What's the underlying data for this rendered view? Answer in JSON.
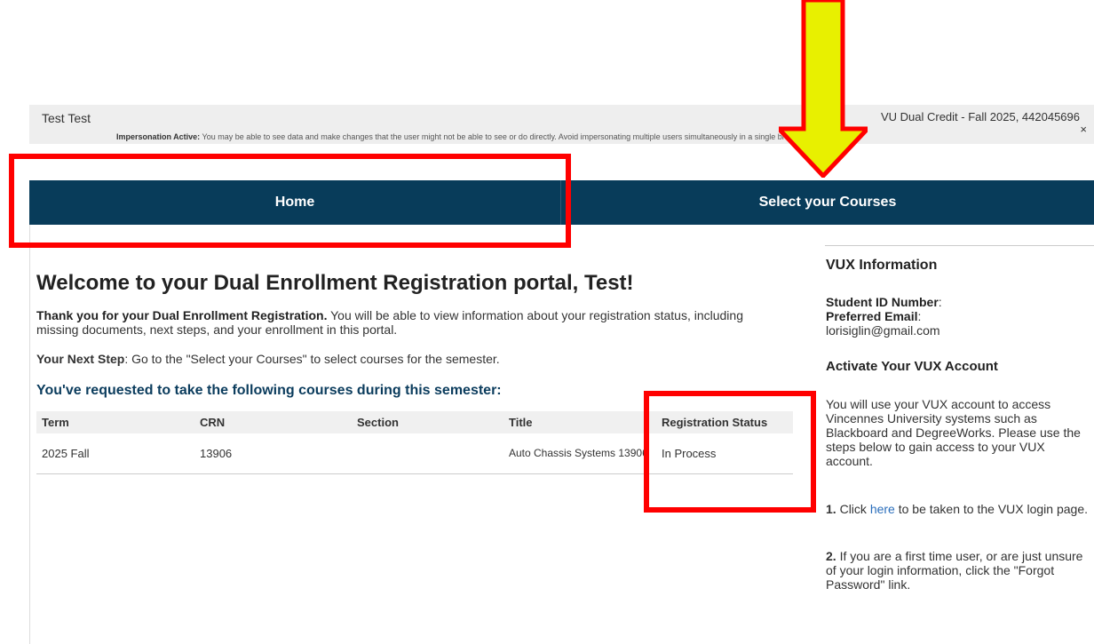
{
  "header": {
    "user_name": "Test Test",
    "impersonation_label": "Impersonation Active:",
    "impersonation_text": "You may be able to see data and make changes that the user might not be able to see or do directly. Avoid impersonating multiple users simultaneously in a single browser session.",
    "session_info": "VU Dual Credit - Fall 2025, 442045696",
    "close_glyph": "×"
  },
  "nav": {
    "home_label": "Home",
    "select_courses_label": "Select your Courses"
  },
  "main": {
    "welcome": "Welcome to your Dual Enrollment Registration portal, Test!",
    "intro_bold": "Thank you for your Dual Enrollment Registration.",
    "intro_text": " You will be able to view information about your registration status, including missing documents, next steps, and your enrollment in this portal.",
    "next_step_label": "Your Next Step",
    "next_step_text": ": Go to the \"Select your Courses\" to select courses for the semester.",
    "courses_heading": "You've requested to take the following courses during this semester:",
    "table": {
      "headers": [
        "Term",
        "CRN",
        "Section",
        "Title",
        "Registration Status"
      ],
      "rows": [
        {
          "term": "2025 Fall",
          "crn": "13906",
          "section": "",
          "title": "Auto Chassis Systems 13906",
          "status": "In Process"
        }
      ]
    }
  },
  "sidebar": {
    "heading": "VUX Information",
    "student_id_label": "Student ID Number",
    "student_id_value": ":",
    "email_label": "Preferred Email",
    "email_colon": ":",
    "email_value": "lorisiglin@gmail.com",
    "activate_heading": "Activate Your VUX Account",
    "activate_text": "You will use your VUX account to access Vincennes University systems such as Blackboard and DegreeWorks. Please use the steps below to gain access to your VUX account.",
    "step1_num": "1.",
    "step1_pre": " Click ",
    "step1_link": "here",
    "step1_post": " to be taken to the VUX login page.",
    "step2_num": "2.",
    "step2_text": " If you are a first time user, or are just unsure of your login information, click the \"Forgot Password\" link."
  },
  "annotations": {
    "box_color": "#ff0000",
    "arrow_fill": "#e8f000",
    "arrow_stroke": "#ff0000"
  }
}
